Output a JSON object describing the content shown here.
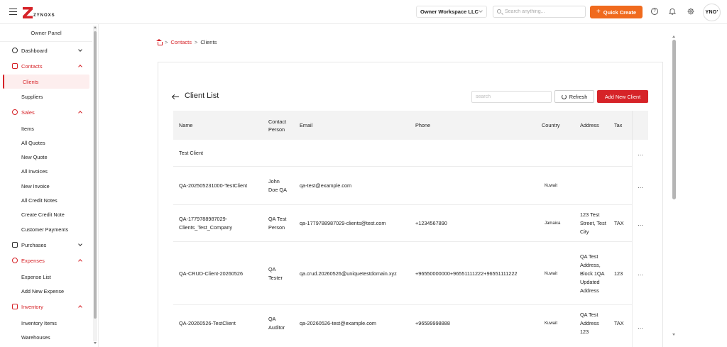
{
  "brand": {
    "logo_text": "ZYNOXS"
  },
  "topbar": {
    "workspace": "Owner Workspace LLC",
    "search_placeholder": "Search anything...",
    "quick_create": "Quick Create",
    "help_glyph": "?",
    "avatar_text": "YNO'",
    "accent_color": "#f06a1d"
  },
  "sidebar": {
    "panel_title": "Owner Panel",
    "items": [
      {
        "label": "Dashboard",
        "type": "section",
        "icon": "dashboard-icon"
      },
      {
        "label": "Contacts",
        "type": "section",
        "icon": "contacts-icon",
        "expanded": true
      },
      {
        "label": "Clients",
        "type": "sub",
        "active": true
      },
      {
        "label": "Suppliers",
        "type": "sub"
      },
      {
        "label": "Sales",
        "type": "section",
        "icon": "sales-icon",
        "expanded": true
      },
      {
        "label": "Items",
        "type": "sub"
      },
      {
        "label": "All Quotes",
        "type": "sub"
      },
      {
        "label": "New Quote",
        "type": "sub"
      },
      {
        "label": "All Invoices",
        "type": "sub"
      },
      {
        "label": "New Invoice",
        "type": "sub"
      },
      {
        "label": "All Credit Notes",
        "type": "sub"
      },
      {
        "label": "Create Credit Note",
        "type": "sub"
      },
      {
        "label": "Customer Payments",
        "type": "sub"
      },
      {
        "label": "Purchases",
        "type": "section",
        "icon": "cart-icon"
      },
      {
        "label": "Expenses",
        "type": "section",
        "icon": "expenses-icon",
        "expanded": true
      },
      {
        "label": "Expense List",
        "type": "sub"
      },
      {
        "label": "Add New Expense",
        "type": "sub"
      },
      {
        "label": "Inventory",
        "type": "section",
        "icon": "inventory-icon",
        "expanded": true
      },
      {
        "label": "Inventory Items",
        "type": "sub"
      },
      {
        "label": "Warehouses",
        "type": "sub"
      }
    ]
  },
  "breadcrumb": {
    "sep": ">",
    "link": "Contacts",
    "current": "Clients"
  },
  "client_list": {
    "title": "Client List",
    "search_placeholder": "search",
    "refresh_label": "Refresh",
    "add_label": "Add New Client",
    "columns": [
      "Name",
      "Contact Person",
      "Email",
      "Phone",
      "Country",
      "Address",
      "Tax"
    ],
    "rows": [
      {
        "name": "Test Client",
        "contact": "",
        "email": "",
        "phone": "",
        "country": "",
        "address": "",
        "tax": ""
      },
      {
        "name": "QA-202505231000-TestClient",
        "contact": "John Doe QA",
        "email": "qa-test@example.com",
        "phone": "",
        "country": "Kuwait",
        "address": "",
        "tax": ""
      },
      {
        "name": "QA-1779788987029-Clients_Test_Company",
        "contact": "QA Test Person",
        "email": "qa-1779788987029-clients@test.com",
        "phone": "+1234567890",
        "country": "Jamaica",
        "address": "123 Test Street, Test City",
        "tax": "TAX"
      },
      {
        "name": "QA-CRUD-Client-20260526",
        "contact": "QA Tester",
        "email": "qa.crud.20260526@uniquetestdomain.xyz",
        "phone": "+96550000000+96551111222+96551111222",
        "country": "Kuwait",
        "address": "QA Test Address, Block 1QA Updated Address",
        "tax": "123"
      },
      {
        "name": "QA-20260526-TestClient",
        "contact": "QA Auditor",
        "email": "qa-20260526-test@example.com",
        "phone": "+96599998888",
        "country": "Kuwait",
        "address": "QA Test Address 123",
        "tax": "TAX"
      }
    ],
    "row_action_glyph": "..."
  }
}
